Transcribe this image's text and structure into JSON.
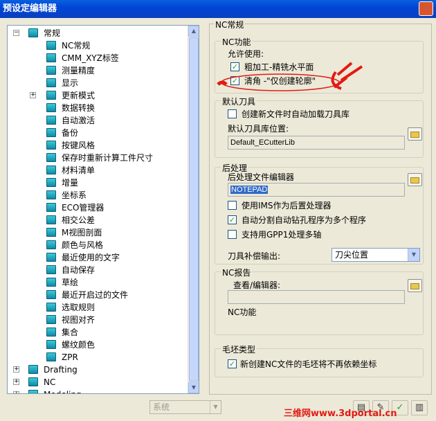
{
  "window": {
    "title": "预设定编辑器"
  },
  "tree": {
    "items": [
      {
        "label": "常规",
        "level": 0,
        "expander": "−"
      },
      {
        "label": "NC常规",
        "level": 1
      },
      {
        "label": "CMM_XYZ标签",
        "level": 1
      },
      {
        "label": "测量精度",
        "level": 1
      },
      {
        "label": "显示",
        "level": 1
      },
      {
        "label": "更新模式",
        "level": 1,
        "expander": "+"
      },
      {
        "label": "数据转换",
        "level": 1
      },
      {
        "label": "自动激活",
        "level": 1
      },
      {
        "label": "备份",
        "level": 1
      },
      {
        "label": "按键风格",
        "level": 1
      },
      {
        "label": "保存时重新计算工件尺寸",
        "level": 1
      },
      {
        "label": "材料清单",
        "level": 1
      },
      {
        "label": "增量",
        "level": 1
      },
      {
        "label": "坐标系",
        "level": 1
      },
      {
        "label": "ECO管理器",
        "level": 1
      },
      {
        "label": "相交公差",
        "level": 1
      },
      {
        "label": "M视图剖面",
        "level": 1
      },
      {
        "label": "颜色与风格",
        "level": 1
      },
      {
        "label": "最近使用的文字",
        "level": 1
      },
      {
        "label": "自动保存",
        "level": 1
      },
      {
        "label": "草绘",
        "level": 1
      },
      {
        "label": "最近开启过的文件",
        "level": 1
      },
      {
        "label": "选取规则",
        "level": 1
      },
      {
        "label": "视图对齐",
        "level": 1
      },
      {
        "label": "集合",
        "level": 1
      },
      {
        "label": "螺纹颜色",
        "level": 1
      },
      {
        "label": "ZPR",
        "level": 1
      },
      {
        "label": "Drafting",
        "level": 0,
        "expander": "+"
      },
      {
        "label": "NC",
        "level": 0,
        "expander": "+"
      },
      {
        "label": "Modeling",
        "level": 0,
        "expander": "+"
      }
    ]
  },
  "panel": {
    "title": "NC常规",
    "nc_function": {
      "title": "NC功能",
      "allow_label": "允许使用:",
      "option1": {
        "label": "粗加工-精铣水平面",
        "checked": true
      },
      "option2": {
        "label": "清角 -\"仅创建轮廓\"",
        "checked": true
      }
    },
    "default_tool": {
      "title": "默认刀具",
      "autoload": {
        "label": "创建新文件时自动加载刀具库",
        "checked": false
      },
      "location_label": "默认刀具库位置:",
      "location_value": "Default_ECutterLib"
    },
    "postprocess": {
      "title": "后处理",
      "editor_label": "后处理文件编辑器",
      "editor_value": "NOTEPAD",
      "use_ims": {
        "label": "使用IMS作为后置处理器",
        "checked": false
      },
      "split_drill": {
        "label": "自动分割自动钻孔程序为多个程序",
        "checked": true
      },
      "gpp1": {
        "label": "支持用GPP1处理多轴",
        "checked": false
      },
      "comp_label": "刀具补偿输出:",
      "comp_value": "刀尖位置"
    },
    "nc_report": {
      "title": "NC报告",
      "viewer_label": "查看/编辑器:",
      "viewer_value": "",
      "nc_func_label": "NC功能"
    },
    "stock": {
      "title": "毛坯类型",
      "option": {
        "label": "新创建NC文件的毛坯将不再依赖坐标",
        "checked": true
      }
    }
  },
  "footer": {
    "scope_select": "系统",
    "watermark": "三维网www.3dportal.cn"
  }
}
